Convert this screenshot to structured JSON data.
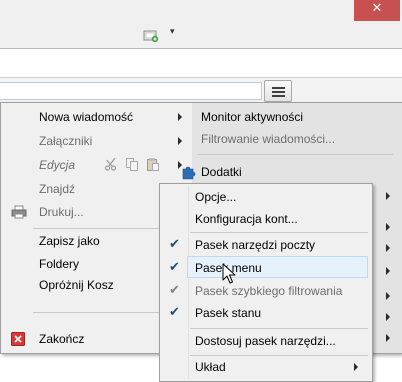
{
  "window": {
    "close_glyph": "✕",
    "addon_icon": "extension-icon",
    "addon_arrow": "▾",
    "accent_close": "#c75050"
  },
  "app_menu_button": {
    "icon": "hamburger-menu-icon"
  },
  "menu_left": [
    {
      "label": "Nowa wiadomość",
      "submenu": true,
      "disabled": false
    },
    {
      "label": "Załączniki",
      "submenu": true,
      "disabled": true
    },
    {
      "label": "Edycja",
      "submenu": true,
      "disabled": true,
      "italic": true,
      "edit_icons": [
        "cut-icon",
        "copy-icon",
        "paste-icon"
      ]
    },
    {
      "label": "Znajdź",
      "submenu": false,
      "disabled": true
    },
    {
      "label": "Drukuj...",
      "submenu": false,
      "disabled": true,
      "icon": "printer-icon"
    },
    {
      "label": "Zapisz jako",
      "submenu": true,
      "disabled": false
    },
    {
      "label": "Foldery",
      "submenu": true,
      "disabled": false
    },
    {
      "label": "Opróżnij Kosz",
      "submenu": false,
      "disabled": false
    },
    {
      "label": "Zakończ",
      "submenu": false,
      "disabled": false,
      "icon": "exit-icon"
    }
  ],
  "menu_right": [
    {
      "label": "Monitor aktywności",
      "submenu": false,
      "disabled": false
    },
    {
      "label": "Filtrowanie wiadomości...",
      "submenu": false,
      "disabled": true
    },
    {
      "label": "Dodatki",
      "submenu": false,
      "disabled": false,
      "icon": "puzzle-icon"
    }
  ],
  "submenu": {
    "items": [
      {
        "label": "Opcje...",
        "checked": false,
        "disabled": false
      },
      {
        "label": "Konfiguracja kont...",
        "checked": false,
        "disabled": false
      },
      {
        "label": "Pasek narzędzi poczty",
        "checked": true,
        "disabled": false
      },
      {
        "label": "Pasek menu",
        "checked": true,
        "disabled": false,
        "highlighted": true
      },
      {
        "label": "Pasek szybkiego filtrowania",
        "checked": true,
        "disabled": true
      },
      {
        "label": "Pasek stanu",
        "checked": true,
        "disabled": false
      },
      {
        "label": "Dostosuj pasek narzędzi...",
        "checked": false,
        "disabled": false
      },
      {
        "label": "Układ",
        "checked": false,
        "disabled": false,
        "submenu": true
      }
    ],
    "check_glyph": "✔"
  }
}
